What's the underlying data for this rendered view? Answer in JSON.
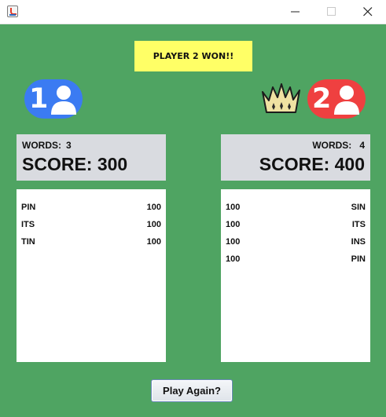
{
  "window": {
    "icon": "java-cup-icon",
    "controls": [
      "minimize-icon",
      "maximize-icon",
      "close-icon"
    ]
  },
  "banner": {
    "text": "PLAYER 2 WON!!"
  },
  "player1": {
    "number": "1",
    "avatar_color": "#3b7bf2",
    "words_label": "WORDS:",
    "words_count": "3",
    "score_text": "SCORE: 300",
    "entries": [
      {
        "word": "PIN",
        "points": "100"
      },
      {
        "word": "ITS",
        "points": "100"
      },
      {
        "word": "TIN",
        "points": "100"
      }
    ]
  },
  "player2": {
    "number": "2",
    "avatar_color": "#ef4040",
    "winner_icon": "crown-icon",
    "words_label": "WORDS:",
    "words_count": "4",
    "score_text": "SCORE: 400",
    "entries": [
      {
        "points": "100",
        "word": "SIN"
      },
      {
        "points": "100",
        "word": "ITS"
      },
      {
        "points": "100",
        "word": "INS"
      },
      {
        "points": "100",
        "word": "PIN"
      }
    ]
  },
  "actions": {
    "play_again_label": "Play Again?"
  },
  "colors": {
    "background": "#4fa462",
    "banner": "#ffff66",
    "score_panel": "#d9dbe0"
  }
}
